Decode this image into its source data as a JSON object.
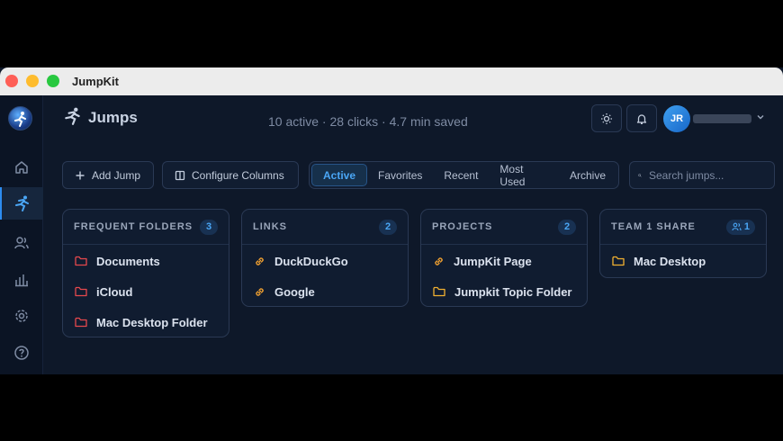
{
  "window": {
    "title": "JumpKit"
  },
  "header": {
    "title": "Jumps",
    "stats": "10 active · 28 clicks · 4.7 min saved",
    "avatar_initials": "JR"
  },
  "toolbar": {
    "add_label": "Add Jump",
    "configure_label": "Configure Columns",
    "tabs": [
      {
        "label": "Active",
        "active": true
      },
      {
        "label": "Favorites",
        "active": false
      },
      {
        "label": "Recent",
        "active": false
      },
      {
        "label": "Most Used",
        "active": false
      },
      {
        "label": "Archive",
        "active": false
      }
    ],
    "search_placeholder": "Search jumps..."
  },
  "sidebar": {
    "items": [
      {
        "icon": "home-icon",
        "active": false
      },
      {
        "icon": "jumps-icon",
        "active": true
      },
      {
        "icon": "users-icon",
        "active": false
      },
      {
        "icon": "chart-icon",
        "active": false
      },
      {
        "icon": "gear-icon",
        "active": false
      },
      {
        "icon": "help-icon",
        "active": false
      }
    ]
  },
  "cards": [
    {
      "title": "FREQUENT FOLDERS",
      "count": "3",
      "items": [
        {
          "label": "Documents",
          "icon": "folder-icon",
          "color": "#e5484d"
        },
        {
          "label": "iCloud",
          "icon": "folder-icon",
          "color": "#e5484d"
        },
        {
          "label": "Mac Desktop Folder",
          "icon": "folder-icon",
          "color": "#e5484d"
        }
      ]
    },
    {
      "title": "LINKS",
      "count": "2",
      "items": [
        {
          "label": "DuckDuckGo",
          "icon": "link-icon",
          "color": "#f0a030"
        },
        {
          "label": "Google",
          "icon": "link-icon",
          "color": "#f0a030"
        }
      ]
    },
    {
      "title": "PROJECTS",
      "count": "2",
      "items": [
        {
          "label": "JumpKit Page",
          "icon": "link-icon",
          "color": "#f0a030"
        },
        {
          "label": "Jumpkit Topic Folder",
          "icon": "folder-icon",
          "color": "#f0b030"
        }
      ]
    },
    {
      "title": "TEAM 1 SHARE",
      "count": "1",
      "items": [
        {
          "label": "Mac Desktop",
          "icon": "folder-icon",
          "color": "#f0b030"
        }
      ]
    }
  ],
  "colors": {
    "accent": "#4aa6f5",
    "background": "#0e1829",
    "folder_red": "#e5484d",
    "folder_yellow": "#f0b030"
  }
}
